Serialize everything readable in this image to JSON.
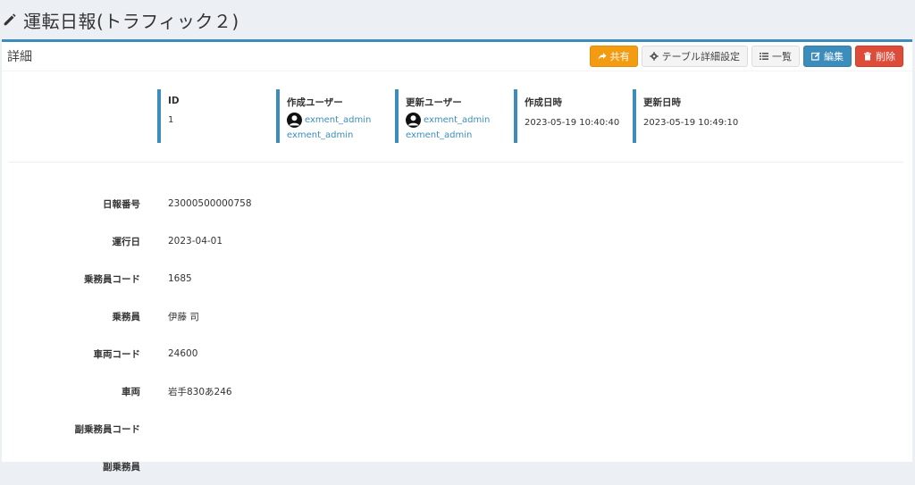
{
  "page": {
    "title": "運転日報(トラフィック２)"
  },
  "box": {
    "title": "詳細"
  },
  "toolbar": {
    "share": "共有",
    "table_settings": "テーブル詳細設定",
    "list": "一覧",
    "edit": "編集",
    "delete": "削除"
  },
  "meta": {
    "id": {
      "label": "ID",
      "value": "1"
    },
    "created_user": {
      "label": "作成ユーザー",
      "name": "exment_admin",
      "sub": "exment_admin"
    },
    "updated_user": {
      "label": "更新ユーザー",
      "name": "exment_admin",
      "sub": "exment_admin"
    },
    "created_at": {
      "label": "作成日時",
      "value": "2023-05-19 10:40:40"
    },
    "updated_at": {
      "label": "更新日時",
      "value": "2023-05-19 10:49:10"
    }
  },
  "fields": [
    {
      "label": "日報番号",
      "value": "23000500000758"
    },
    {
      "label": "運行日",
      "value": "2023-04-01"
    },
    {
      "label": "乗務員コード",
      "value": "1685"
    },
    {
      "label": "乗務員",
      "value": "伊藤 司"
    },
    {
      "label": "車両コード",
      "value": "24600"
    },
    {
      "label": "車両",
      "value": "岩手830あ246"
    },
    {
      "label": "副乗務員コード",
      "value": ""
    },
    {
      "label": "副乗務員",
      "value": ""
    }
  ],
  "colors": {
    "accent": "#3c8dbc",
    "warning": "#f39c12",
    "danger": "#dd4b39"
  }
}
